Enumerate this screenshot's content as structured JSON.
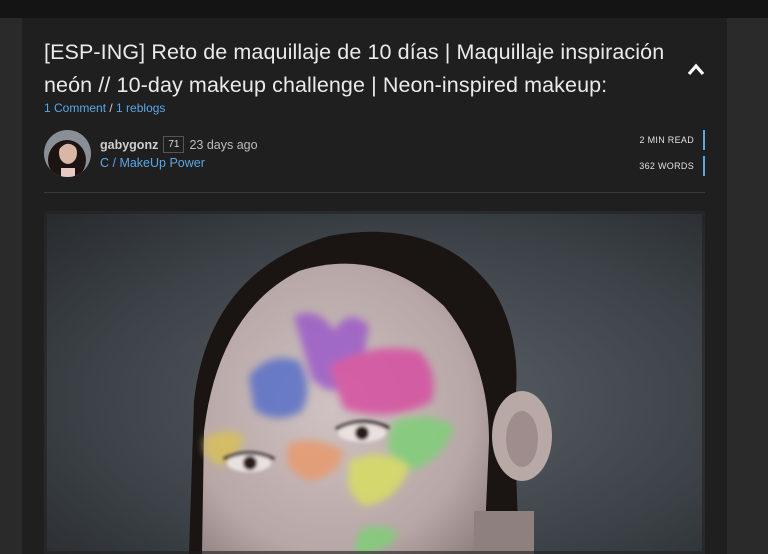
{
  "post": {
    "title": "[ESP-ING] Reto de maquillaje de 10 días | Maquillaje inspiración neón // 10-day makeup challenge | Neon-inspired makeup:",
    "comments_label": "1 Comment",
    "separator": " / ",
    "reblogs_label": "1 reblogs"
  },
  "author": {
    "name": "gabygonz",
    "reputation": "71",
    "posted_ago": "23 days ago",
    "community": "C / MakeUp Power"
  },
  "stats": {
    "read_time": "2 MIN READ",
    "word_count": "362 WORDS"
  },
  "icons": {
    "collapse": "chevron-up-icon"
  },
  "colors": {
    "link": "#5aa7e6",
    "panel": "#1f1f1f"
  }
}
